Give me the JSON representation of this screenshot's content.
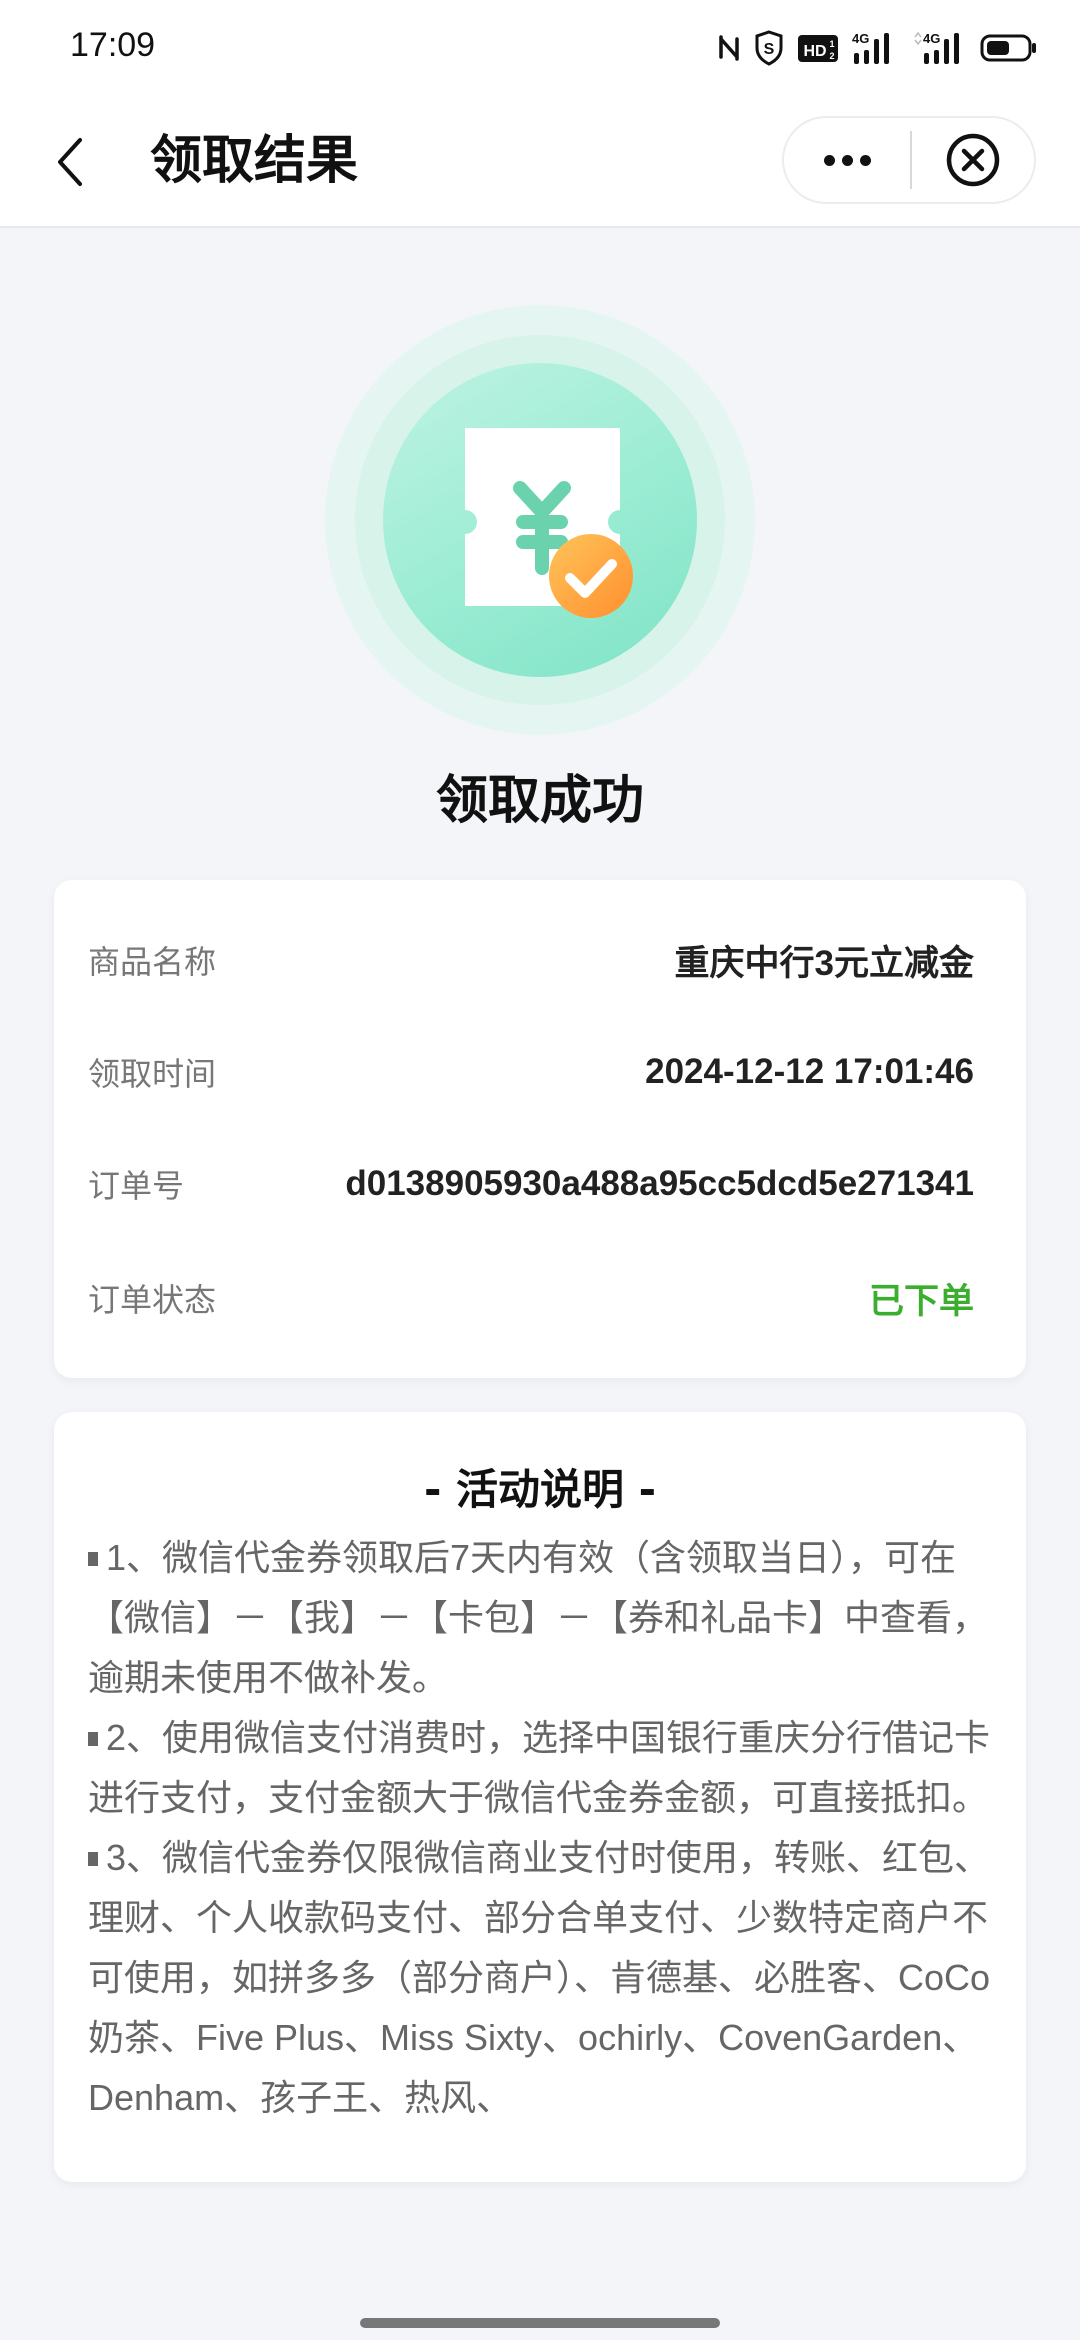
{
  "status_bar": {
    "time": "17:09",
    "icons": [
      "nfc-icon",
      "shield-s-icon",
      "hd-icon",
      "signal-4g-icon",
      "signal-4g-icon",
      "battery-icon"
    ],
    "network_label_1": "4G",
    "network_label_2": "4G",
    "hd_label": "HD"
  },
  "navbar": {
    "title": "领取结果",
    "back_icon": "chevron-left-icon",
    "more_icon": "more-dots-icon",
    "close_icon": "close-circle-icon"
  },
  "hero": {
    "icon": "coupon-yen-check-icon",
    "title": "领取成功"
  },
  "info": {
    "rows": [
      {
        "label": "商品名称",
        "value": "重庆中行3元立减金"
      },
      {
        "label": "领取时间",
        "value": "2024-12-12 17:01:46"
      },
      {
        "label": "订单号",
        "value": "d0138905930a488a95cc5dcd5e271341"
      },
      {
        "label": "订单状态",
        "value": "已下单"
      }
    ],
    "status_color": "#3cae2f"
  },
  "rules": {
    "title": "- 活动说明 -",
    "items": [
      "1、微信代金券领取后7天内有效（含领取当日），可在【微信】－【我】－【卡包】－【券和礼品卡】中查看，逾期未使用不做补发。",
      "2、使用微信支付消费时，选择中国银行重庆分行借记卡进行支付，支付金额大于微信代金券金额，可直接抵扣。",
      "3、微信代金券仅限微信商业支付时使用，转账、红包、理财、个人收款码支付、部分合单支付、少数特定商户不可使用，如拼多多（部分商户）、肯德基、必胜客、CoCo奶茶、Five Plus、Miss Sixty、ochirly、CovenGarden、Denham、孩子王、热风、"
    ]
  },
  "colors": {
    "accent_green": "#7fe3c5",
    "check_orange": "#ffa23e",
    "page_bg": "#f3f5f9"
  }
}
